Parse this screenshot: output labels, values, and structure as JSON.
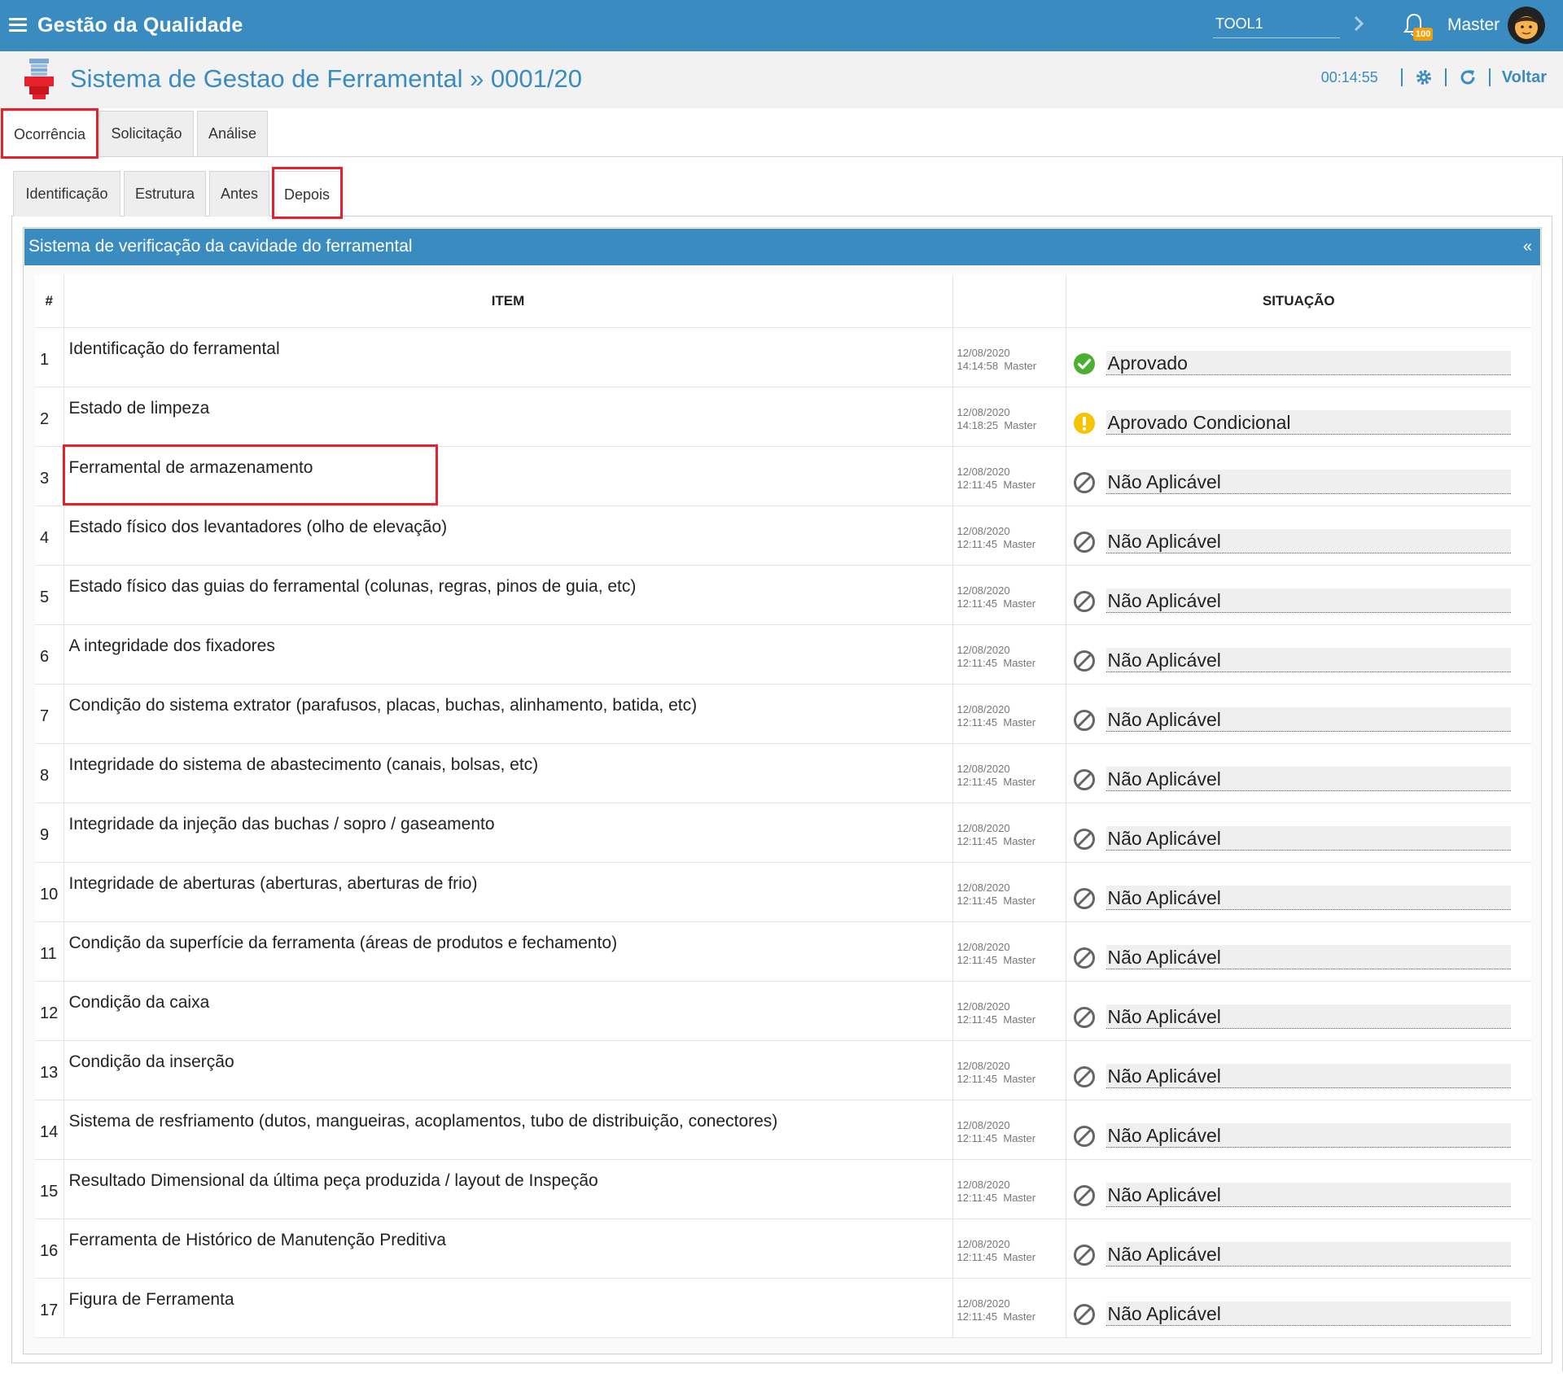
{
  "app": {
    "title": "Gestão da Qualidade",
    "tool_value": "TOOL1",
    "notification_count": "100",
    "user": "Master",
    "brand_color": "#3a8cc0"
  },
  "header": {
    "title": "Sistema de Gestao de Ferramental » 0001/20",
    "timer": "00:14:55",
    "back_label": "Voltar"
  },
  "tabs": [
    {
      "label": "Ocorrência",
      "active": true
    },
    {
      "label": "Solicitação",
      "active": false
    },
    {
      "label": "Análise",
      "active": false
    }
  ],
  "subtabs": [
    {
      "label": "Identificação",
      "active": false
    },
    {
      "label": "Estrutura",
      "active": false
    },
    {
      "label": "Antes",
      "active": false
    },
    {
      "label": "Depois",
      "active": true
    }
  ],
  "section": {
    "title": "Sistema de verificação da cavidade do ferramental",
    "collapse_glyph": "«"
  },
  "table": {
    "headers": {
      "num": "#",
      "item": "ITEM",
      "meta": "",
      "status": "SITUAÇÃO"
    },
    "rows": [
      {
        "num": "1",
        "item": "Identificação do ferramental",
        "date": "12/08/2020",
        "time": "14:14:58",
        "user": "Master",
        "status": "Aprovado",
        "status_icon": "check-circle-icon"
      },
      {
        "num": "2",
        "item": "Estado de limpeza",
        "date": "12/08/2020",
        "time": "14:18:25",
        "user": "Master",
        "status": "Aprovado Condicional",
        "status_icon": "warning-circle-icon"
      },
      {
        "num": "3",
        "item": "Ferramental de armazenamento",
        "date": "12/08/2020",
        "time": "12:11:45",
        "user": "Master",
        "status": "Não Aplicável",
        "status_icon": "not-applicable-icon"
      },
      {
        "num": "4",
        "item": "Estado físico dos levantadores (olho de elevação)",
        "date": "12/08/2020",
        "time": "12:11:45",
        "user": "Master",
        "status": "Não Aplicável",
        "status_icon": "not-applicable-icon"
      },
      {
        "num": "5",
        "item": "Estado físico das guias do ferramental (colunas, regras, pinos de guia, etc)",
        "date": "12/08/2020",
        "time": "12:11:45",
        "user": "Master",
        "status": "Não Aplicável",
        "status_icon": "not-applicable-icon"
      },
      {
        "num": "6",
        "item": "A integridade dos fixadores",
        "date": "12/08/2020",
        "time": "12:11:45",
        "user": "Master",
        "status": "Não Aplicável",
        "status_icon": "not-applicable-icon"
      },
      {
        "num": "7",
        "item": "Condição do sistema extrator (parafusos, placas, buchas, alinhamento, batida, etc)",
        "date": "12/08/2020",
        "time": "12:11:45",
        "user": "Master",
        "status": "Não Aplicável",
        "status_icon": "not-applicable-icon"
      },
      {
        "num": "8",
        "item": "Integridade do sistema de abastecimento (canais, bolsas, etc)",
        "date": "12/08/2020",
        "time": "12:11:45",
        "user": "Master",
        "status": "Não Aplicável",
        "status_icon": "not-applicable-icon"
      },
      {
        "num": "9",
        "item": "Integridade da injeção das buchas / sopro / gaseamento",
        "date": "12/08/2020",
        "time": "12:11:45",
        "user": "Master",
        "status": "Não Aplicável",
        "status_icon": "not-applicable-icon"
      },
      {
        "num": "10",
        "item": "Integridade de aberturas (aberturas, aberturas de frio)",
        "date": "12/08/2020",
        "time": "12:11:45",
        "user": "Master",
        "status": "Não Aplicável",
        "status_icon": "not-applicable-icon"
      },
      {
        "num": "11",
        "item": "Condição da superfície da ferramenta (áreas de produtos e fechamento)",
        "date": "12/08/2020",
        "time": "12:11:45",
        "user": "Master",
        "status": "Não Aplicável",
        "status_icon": "not-applicable-icon"
      },
      {
        "num": "12",
        "item": "Condição da caixa",
        "date": "12/08/2020",
        "time": "12:11:45",
        "user": "Master",
        "status": "Não Aplicável",
        "status_icon": "not-applicable-icon"
      },
      {
        "num": "13",
        "item": "Condição da inserção",
        "date": "12/08/2020",
        "time": "12:11:45",
        "user": "Master",
        "status": "Não Aplicável",
        "status_icon": "not-applicable-icon"
      },
      {
        "num": "14",
        "item": "Sistema de resfriamento (dutos, mangueiras, acoplamentos, tubo de distribuição, conectores)",
        "date": "12/08/2020",
        "time": "12:11:45",
        "user": "Master",
        "status": "Não Aplicável",
        "status_icon": "not-applicable-icon"
      },
      {
        "num": "15",
        "item": "Resultado Dimensional da última peça produzida / layout de Inspeção",
        "date": "12/08/2020",
        "time": "12:11:45",
        "user": "Master",
        "status": "Não Aplicável",
        "status_icon": "not-applicable-icon"
      },
      {
        "num": "16",
        "item": "Ferramenta de Histórico de Manutenção Preditiva",
        "date": "12/08/2020",
        "time": "12:11:45",
        "user": "Master",
        "status": "Não Aplicável",
        "status_icon": "not-applicable-icon"
      },
      {
        "num": "17",
        "item": "Figura de Ferramenta",
        "date": "12/08/2020",
        "time": "12:11:45",
        "user": "Master",
        "status": "Não Aplicável",
        "status_icon": "not-applicable-icon"
      }
    ]
  },
  "status_colors": {
    "approved": "#4caf32",
    "conditional": "#f5c400",
    "not_applicable": "#666666",
    "highlight": "#e8202a"
  }
}
